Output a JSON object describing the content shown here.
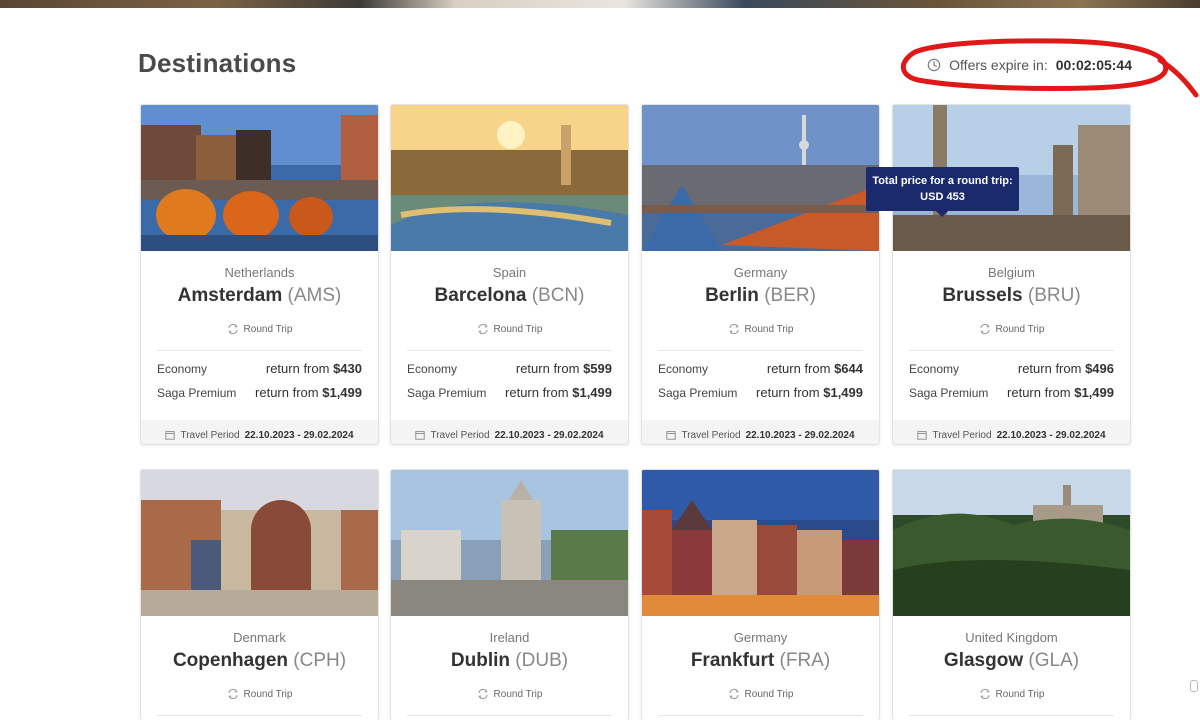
{
  "page": {
    "title": "Destinations",
    "timer_label": "Offers expire in:",
    "timer_value": "00:02:05:44"
  },
  "tooltip": {
    "line1": "Total price for a round trip:",
    "line2": "USD 453"
  },
  "labels": {
    "round_trip": "Round Trip",
    "economy": "Economy",
    "saga_premium": "Saga Premium",
    "return_from": "return from",
    "travel_period": "Travel Period"
  },
  "destinations": [
    {
      "country": "Netherlands",
      "city": "Amsterdam",
      "code": "(AMS)",
      "economy_price": "$430",
      "premium_price": "$1,499",
      "period": "22.10.2023 - 29.02.2024"
    },
    {
      "country": "Spain",
      "city": "Barcelona",
      "code": "(BCN)",
      "economy_price": "$599",
      "premium_price": "$1,499",
      "period": "22.10.2023 - 29.02.2024"
    },
    {
      "country": "Germany",
      "city": "Berlin",
      "code": "(BER)",
      "economy_price": "$644",
      "premium_price": "$1,499",
      "period": "22.10.2023 - 29.02.2024"
    },
    {
      "country": "Belgium",
      "city": "Brussels",
      "code": "(BRU)",
      "economy_price": "$496",
      "premium_price": "$1,499",
      "period": "22.10.2023 - 29.02.2024"
    },
    {
      "country": "Denmark",
      "city": "Copenhagen",
      "code": "(CPH)"
    },
    {
      "country": "Ireland",
      "city": "Dublin",
      "code": "(DUB)"
    },
    {
      "country": "Germany",
      "city": "Frankfurt",
      "code": "(FRA)"
    },
    {
      "country": "United Kingdom",
      "city": "Glasgow",
      "code": "(GLA)"
    }
  ],
  "colors": {
    "tooltip_bg": "#1a2a6c",
    "annotation_red": "#e01818"
  }
}
